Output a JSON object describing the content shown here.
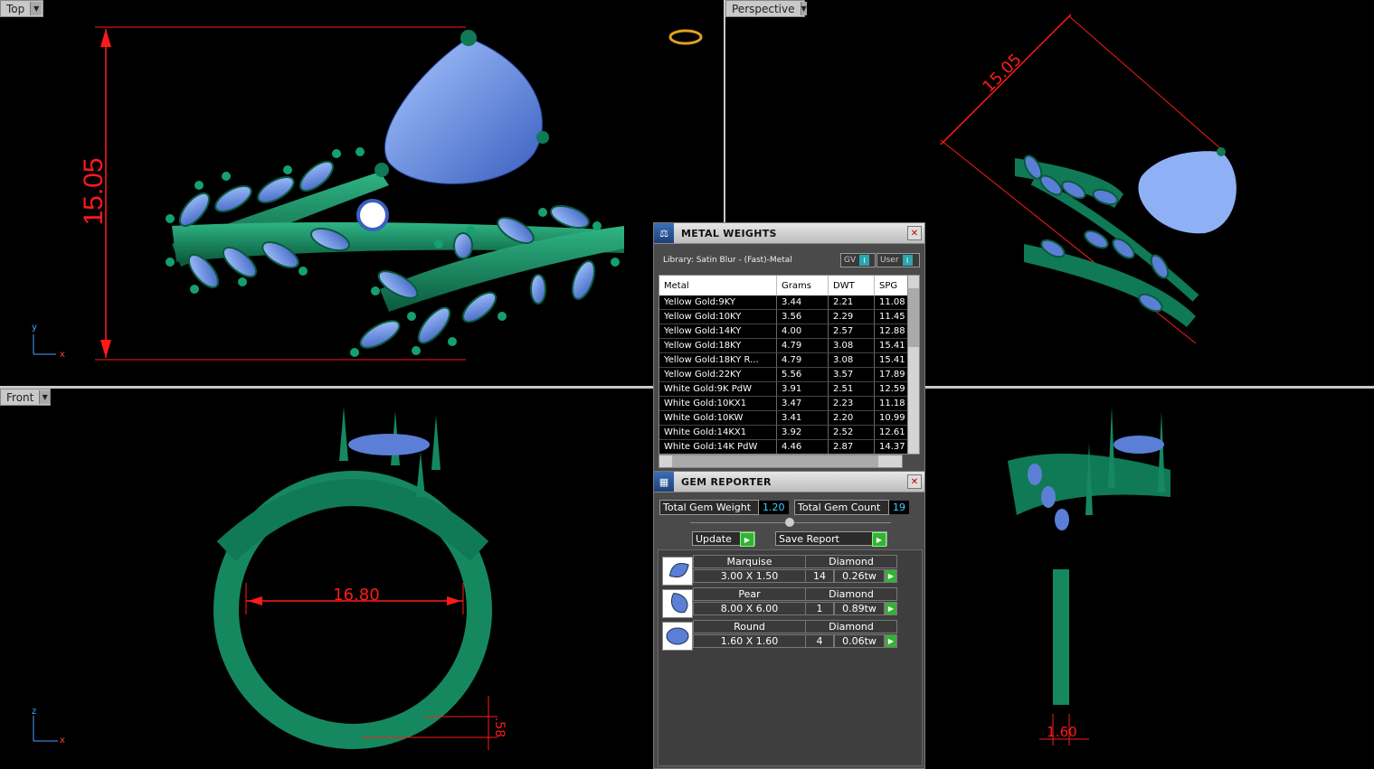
{
  "viewports": {
    "top": {
      "label": "Top",
      "dimension": "15.05",
      "axis_y": "y",
      "axis_x": "x"
    },
    "perspective": {
      "label": "Perspective",
      "dimension": "15.05"
    },
    "front": {
      "label": "Front",
      "dimension_inner": "16.80",
      "dimension_band": ".58",
      "axis_z": "z",
      "axis_x": "x"
    },
    "right": {
      "label": "",
      "dimension": "1.60"
    }
  },
  "metal_weights": {
    "title": "METAL WEIGHTS",
    "library": "Library: Satin Blur - (Fast)-Metal",
    "gv_label": "GV",
    "user_label": "User",
    "columns": [
      "Metal",
      "Grams",
      "DWT",
      "SPG"
    ],
    "rows": [
      {
        "metal": "Yellow Gold:9KY",
        "grams": "3.44",
        "dwt": "2.21",
        "spg": "11.08"
      },
      {
        "metal": "Yellow Gold:10KY",
        "grams": "3.56",
        "dwt": "2.29",
        "spg": "11.45"
      },
      {
        "metal": "Yellow Gold:14KY",
        "grams": "4.00",
        "dwt": "2.57",
        "spg": "12.88"
      },
      {
        "metal": "Yellow Gold:18KY",
        "grams": "4.79",
        "dwt": "3.08",
        "spg": "15.41"
      },
      {
        "metal": "Yellow Gold:18KY R...",
        "grams": "4.79",
        "dwt": "3.08",
        "spg": "15.41"
      },
      {
        "metal": "Yellow Gold:22KY",
        "grams": "5.56",
        "dwt": "3.57",
        "spg": "17.89"
      },
      {
        "metal": "White Gold:9K PdW",
        "grams": "3.91",
        "dwt": "2.51",
        "spg": "12.59"
      },
      {
        "metal": "White Gold:10KX1",
        "grams": "3.47",
        "dwt": "2.23",
        "spg": "11.18"
      },
      {
        "metal": "White Gold:10KW",
        "grams": "3.41",
        "dwt": "2.20",
        "spg": "10.99"
      },
      {
        "metal": "White Gold:14KX1",
        "grams": "3.92",
        "dwt": "2.52",
        "spg": "12.61"
      },
      {
        "metal": "White Gold:14K PdW",
        "grams": "4.46",
        "dwt": "2.87",
        "spg": "14.37"
      }
    ]
  },
  "gem_reporter": {
    "title": "GEM REPORTER",
    "total_weight_label": "Total Gem Weight",
    "total_weight": "1.20",
    "total_count_label": "Total Gem Count",
    "total_count": "19",
    "update_label": "Update",
    "save_label": "Save Report",
    "gems": [
      {
        "shape": "Marquise",
        "material": "Diamond",
        "size": "3.00 X 1.50",
        "count": "14",
        "weight": "0.26tw"
      },
      {
        "shape": "Pear",
        "material": "Diamond",
        "size": "8.00 X 6.00",
        "count": "1",
        "weight": "0.89tw"
      },
      {
        "shape": "Round",
        "material": "Diamond",
        "size": "1.60 X 1.60",
        "count": "4",
        "weight": "0.06tw"
      }
    ]
  },
  "colors": {
    "metal": "#0f7a55",
    "gem": "#5b7fd6",
    "dimension": "#ff1a1a",
    "background": "#000000"
  }
}
